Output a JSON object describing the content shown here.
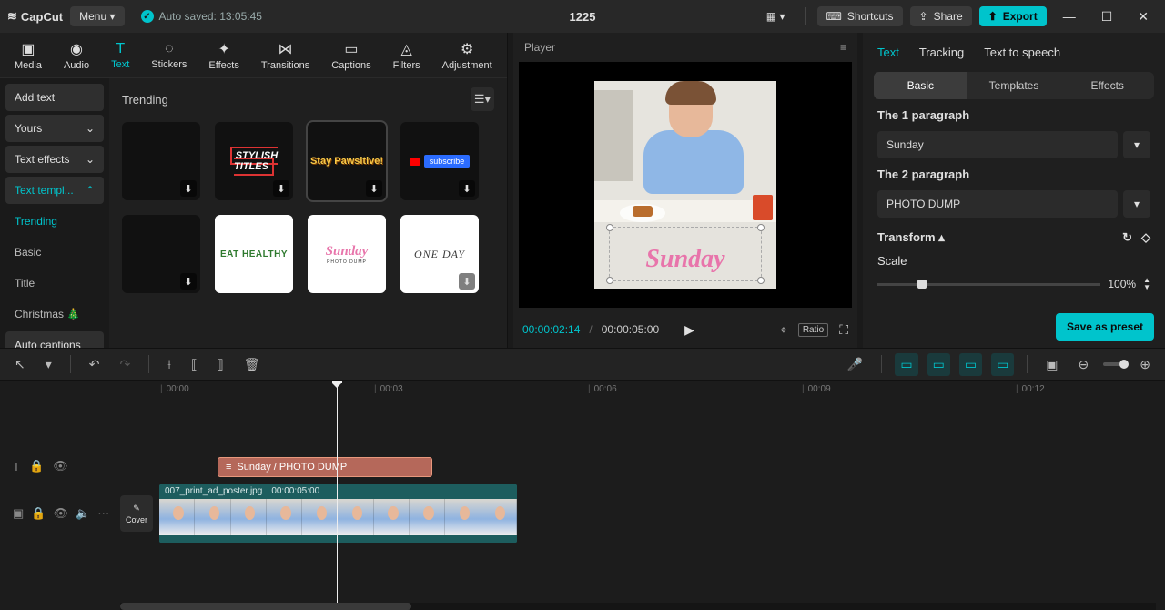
{
  "titlebar": {
    "logo": "CapCut",
    "menu": "Menu ▾",
    "autosave": "Auto saved: 13:05:45",
    "project": "1225",
    "shortcuts": "Shortcuts",
    "share": "Share",
    "export": "Export"
  },
  "tools": {
    "media": "Media",
    "audio": "Audio",
    "text": "Text",
    "stickers": "Stickers",
    "effects": "Effects",
    "transitions": "Transitions",
    "captions": "Captions",
    "filters": "Filters",
    "adjustment": "Adjustment"
  },
  "text_side": {
    "add_text": "Add text",
    "yours": "Yours",
    "text_effects": "Text effects",
    "text_templates": "Text templ...",
    "trending": "Trending",
    "basic": "Basic",
    "title": "Title",
    "christmas": "Christmas 🎄",
    "auto_captions": "Auto captions"
  },
  "grid": {
    "heading": "Trending",
    "items": [
      {
        "id": "blank1",
        "label": ""
      },
      {
        "id": "stylish",
        "label": "STYLISH TITLES"
      },
      {
        "id": "pawsitive",
        "label": "Stay Pawsitive!"
      },
      {
        "id": "subscribe",
        "label": "subscribe"
      },
      {
        "id": "blank2",
        "label": ""
      },
      {
        "id": "eat",
        "label": "EAT HEALTHY"
      },
      {
        "id": "sunday",
        "label": "Sunday",
        "sub": "PHOTO DUMP"
      },
      {
        "id": "oneday",
        "label": "ONE DAY"
      }
    ]
  },
  "player": {
    "title": "Player",
    "current": "00:00:02:14",
    "total": "00:00:05:00",
    "ratio": "Ratio",
    "overlay_text": "Sunday"
  },
  "inspector": {
    "tabs": {
      "text": "Text",
      "tracking": "Tracking",
      "tts": "Text to speech"
    },
    "sub": {
      "basic": "Basic",
      "templates": "Templates",
      "effects": "Effects"
    },
    "para1_label": "The 1 paragraph",
    "para1_value": "Sunday",
    "para2_label": "The 2 paragraph",
    "para2_value": "PHOTO DUMP",
    "transform": "Transform",
    "scale_label": "Scale",
    "scale_value": "100%",
    "save_preset": "Save as preset"
  },
  "timeline": {
    "ticks": [
      "00:00",
      "00:03",
      "00:06",
      "00:09",
      "00:12"
    ],
    "text_clip": "Sunday / PHOTO DUMP",
    "video_name": "007_print_ad_poster.jpg",
    "video_dur": "00:00:05:00",
    "cover": "Cover"
  }
}
